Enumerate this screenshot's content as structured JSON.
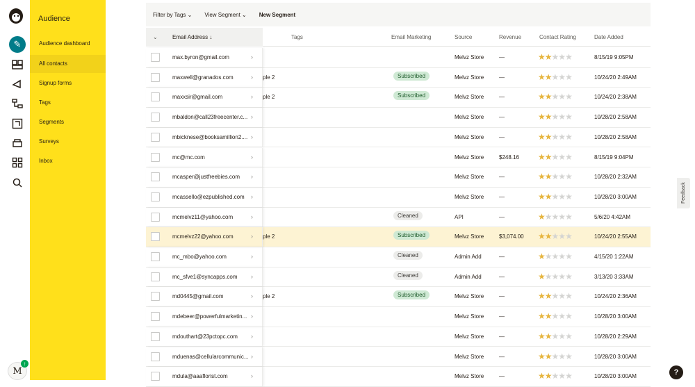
{
  "sidebar": {
    "title": "Audience",
    "items": [
      {
        "label": "Audience dashboard"
      },
      {
        "label": "All contacts"
      },
      {
        "label": "Signup forms"
      },
      {
        "label": "Tags"
      },
      {
        "label": "Segments"
      },
      {
        "label": "Surveys"
      },
      {
        "label": "Inbox"
      }
    ]
  },
  "rail": {
    "avatar_letter": "M",
    "badge": "↑"
  },
  "toolbar": {
    "filter_label": "Filter by Tags",
    "view_segment_label": "View Segment",
    "new_segment_label": "New Segment"
  },
  "table": {
    "headers": {
      "email": "Email Address ↓",
      "tags": "Tags",
      "email_marketing": "Email Marketing",
      "source": "Source",
      "revenue": "Revenue",
      "rating": "Contact Rating",
      "date": "Date Added"
    },
    "rows": [
      {
        "email": "max.byron@gmail.com",
        "tag": "",
        "status": "",
        "source": "Melvz Store",
        "revenue": "—",
        "stars": 2,
        "date": "8/15/19 9:05PM"
      },
      {
        "email": "maxwell@granados.com",
        "tag": "ple 2",
        "status": "Subscribed",
        "source": "Melvz Store",
        "revenue": "—",
        "stars": 2,
        "date": "10/24/20 2:49AM"
      },
      {
        "email": "maxxsir@gmail.com",
        "tag": "ple 2",
        "status": "Subscribed",
        "source": "Melvz Store",
        "revenue": "—",
        "stars": 2,
        "date": "10/24/20 2:38AM"
      },
      {
        "email": "mbaldon@call23freecenter.c...",
        "tag": "",
        "status": "",
        "source": "Melvz Store",
        "revenue": "—",
        "stars": 2,
        "date": "10/28/20 2:58AM"
      },
      {
        "email": "mbicknese@booksamillion2....",
        "tag": "",
        "status": "",
        "source": "Melvz Store",
        "revenue": "—",
        "stars": 2,
        "date": "10/28/20 2:58AM"
      },
      {
        "email": "mc@mc.com",
        "tag": "",
        "status": "",
        "source": "Melvz Store",
        "revenue": "$248.16",
        "stars": 2,
        "date": "8/15/19 9:04PM"
      },
      {
        "email": "mcasper@justfreebies.com",
        "tag": "",
        "status": "",
        "source": "Melvz Store",
        "revenue": "—",
        "stars": 2,
        "date": "10/28/20 2:32AM"
      },
      {
        "email": "mcassello@ezpublished.com",
        "tag": "",
        "status": "",
        "source": "Melvz Store",
        "revenue": "—",
        "stars": 2,
        "date": "10/28/20 3:00AM"
      },
      {
        "email": "mcmelvz11@yahoo.com",
        "tag": "",
        "status": "Cleaned",
        "source": "API",
        "revenue": "—",
        "stars": 1,
        "date": "5/6/20 4:42AM"
      },
      {
        "email": "mcmelvz22@yahoo.com",
        "tag": "ple 2",
        "status": "Subscribed",
        "source": "Melvz Store",
        "revenue": "$3,074.00",
        "stars": 2,
        "date": "10/24/20 2:55AM",
        "highlight": true
      },
      {
        "email": "mc_mbo@yahoo.com",
        "tag": "",
        "status": "Cleaned",
        "source": "Admin Add",
        "revenue": "—",
        "stars": 1,
        "date": "4/15/20 1:22AM"
      },
      {
        "email": "mc_sfve1@syncapps.com",
        "tag": "",
        "status": "Cleaned",
        "source": "Admin Add",
        "revenue": "—",
        "stars": 1,
        "date": "3/13/20 3:33AM"
      },
      {
        "email": "md0445@gmail.com",
        "tag": "ple 2",
        "status": "Subscribed",
        "source": "Melvz Store",
        "revenue": "—",
        "stars": 2,
        "date": "10/24/20 2:36AM"
      },
      {
        "email": "mdebeer@powerfulmarketin...",
        "tag": "",
        "status": "",
        "source": "Melvz Store",
        "revenue": "—",
        "stars": 2,
        "date": "10/28/20 3:00AM"
      },
      {
        "email": "mdouthart@23pctopc.com",
        "tag": "",
        "status": "",
        "source": "Melvz Store",
        "revenue": "—",
        "stars": 2,
        "date": "10/28/20 2:29AM"
      },
      {
        "email": "mduenas@cellularcommunic...",
        "tag": "",
        "status": "",
        "source": "Melvz Store",
        "revenue": "—",
        "stars": 2,
        "date": "10/28/20 3:00AM"
      },
      {
        "email": "mdula@aaaflorist.com",
        "tag": "",
        "status": "",
        "source": "Melvz Store",
        "revenue": "—",
        "stars": 2,
        "date": "10/28/20 3:00AM"
      }
    ]
  },
  "feedback_label": "Feedback",
  "help_label": "?",
  "icons": [
    "mailchimp-logo-icon",
    "pencil-icon",
    "audience-icon",
    "campaigns-icon",
    "automations-icon",
    "website-icon",
    "content-icon",
    "integrations-icon",
    "search-icon",
    "chevron-right-icon",
    "star-icon"
  ],
  "colors": {
    "sidebar_bg": "#ffe01b",
    "accent": "#007c89",
    "subscribed_bg": "#cfe9d4",
    "highlight_row": "#fdf3d3",
    "star": "#e6b43c"
  }
}
